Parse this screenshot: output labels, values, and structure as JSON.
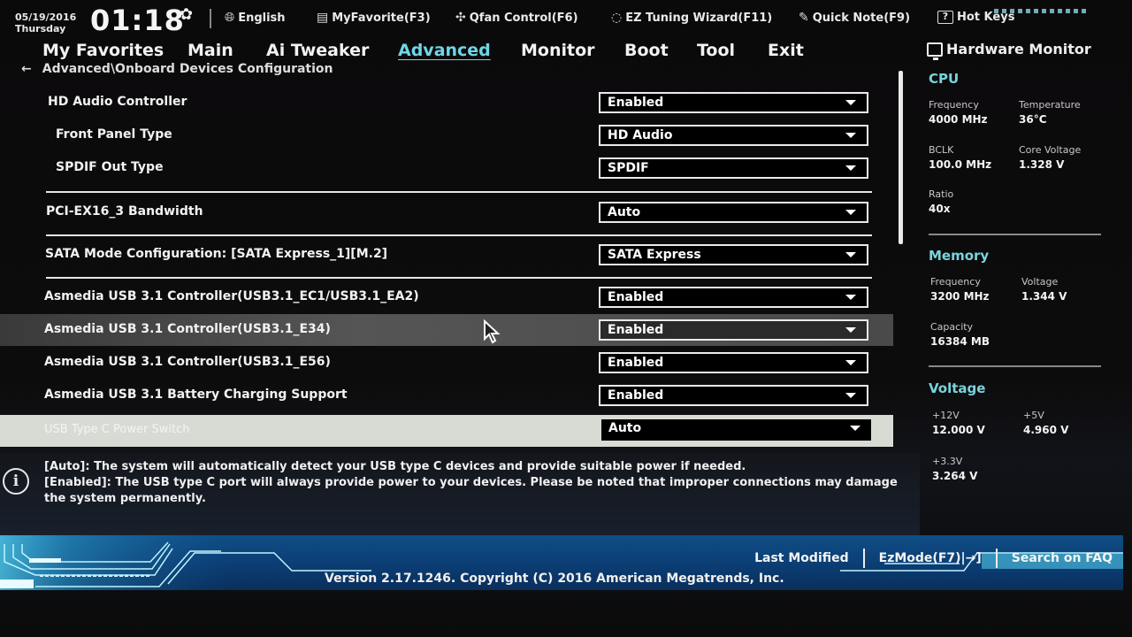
{
  "topbar": {
    "date": "05/19/2016",
    "day": "Thursday",
    "time": "01:18",
    "items": [
      {
        "label": "English",
        "icon": "globe-icon"
      },
      {
        "label": "MyFavorite(F3)",
        "icon": "favorite-list-icon"
      },
      {
        "label": "Qfan Control(F6)",
        "icon": "fan-icon"
      },
      {
        "label": "EZ Tuning Wizard(F11)",
        "icon": "lightbulb-icon"
      },
      {
        "label": "Quick Note(F9)",
        "icon": "note-icon"
      },
      {
        "label": "Hot Keys",
        "icon": "help-box-icon"
      }
    ]
  },
  "nav": {
    "tabs": [
      {
        "label": "My Favorites"
      },
      {
        "label": "Main"
      },
      {
        "label": "Ai Tweaker"
      },
      {
        "label": "Advanced",
        "active": true
      },
      {
        "label": "Monitor"
      },
      {
        "label": "Boot"
      },
      {
        "label": "Tool"
      },
      {
        "label": "Exit"
      }
    ]
  },
  "breadcrumb": {
    "back_icon": "←",
    "path": "Advanced\\Onboard Devices Configuration"
  },
  "settings": [
    {
      "label": "HD Audio Controller",
      "value": "Enabled"
    },
    {
      "label": "Front Panel Type",
      "value": "HD Audio"
    },
    {
      "label": "SPDIF Out Type",
      "value": "SPDIF"
    },
    {
      "label": "PCI-EX16_3 Bandwidth",
      "value": "Auto"
    },
    {
      "label": "SATA Mode Configuration: [SATA Express_1][M.2]",
      "value": "SATA Express"
    },
    {
      "label": "Asmedia USB 3.1 Controller(USB3.1_EC1/USB3.1_EA2)",
      "value": "Enabled"
    },
    {
      "label": "Asmedia USB 3.1 Controller(USB3.1_E34)",
      "value": "Enabled"
    },
    {
      "label": "Asmedia USB 3.1 Controller(USB3.1_E56)",
      "value": "Enabled"
    },
    {
      "label": "Asmedia USB 3.1 Battery Charging Support",
      "value": "Enabled"
    },
    {
      "label": "USB Type C Power Switch",
      "value": "Auto"
    }
  ],
  "help": {
    "lines": [
      "[Auto]: The system will automatically detect your USB type C devices and provide suitable power if needed.",
      "[Enabled]: The USB type C port will always provide power to your devices. Please be noted that improper connections may damage the system permanently."
    ]
  },
  "hardware_monitor": {
    "title": "Hardware Monitor",
    "cpu": {
      "title": "CPU",
      "frequency_label": "Frequency",
      "frequency": "4000 MHz",
      "temperature_label": "Temperature",
      "temperature": "36°C",
      "bclk_label": "BCLK",
      "bclk": "100.0 MHz",
      "core_voltage_label": "Core Voltage",
      "core_voltage": "1.328 V",
      "ratio_label": "Ratio",
      "ratio": "40x"
    },
    "memory": {
      "title": "Memory",
      "frequency_label": "Frequency",
      "frequency": "3200 MHz",
      "voltage_label": "Voltage",
      "voltage": "1.344 V",
      "capacity_label": "Capacity",
      "capacity": "16384 MB"
    },
    "voltage": {
      "title": "Voltage",
      "v12_label": "+12V",
      "v12": "12.000 V",
      "v5_label": "+5V",
      "v5": "4.960 V",
      "v33_label": "+3.3V",
      "v33": "3.264 V"
    }
  },
  "footer": {
    "last_modified": "Last Modified",
    "ezmode": "EzMode(F7)|→]",
    "search_faq": "Search on FAQ",
    "version": "Version 2.17.1246. Copyright (C) 2016 American Megatrends, Inc."
  },
  "colors": {
    "accent": "#6fd6e8",
    "section_title": "#79d4dc",
    "footer_blue": "#0f4e86"
  }
}
